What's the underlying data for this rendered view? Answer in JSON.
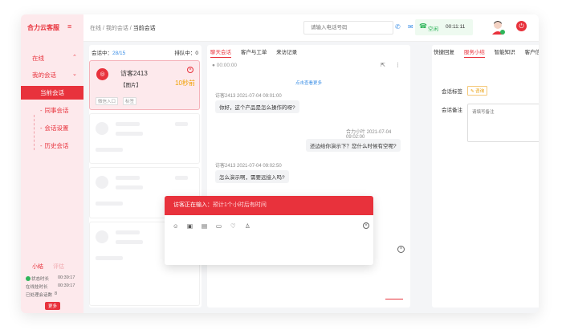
{
  "sidebar": {
    "brand": "合力云客服",
    "menu_icon": "≡",
    "online": "在线",
    "my_sessions": "我的会话",
    "items": [
      {
        "label": "当前会话",
        "active": true
      },
      {
        "label": "同事会话",
        "active": false
      },
      {
        "label": "会话设置",
        "active": false
      },
      {
        "label": "历史会话",
        "active": false
      }
    ],
    "summary_tabs": [
      "小结",
      "评估"
    ],
    "summary": [
      {
        "label": "状态时长",
        "value": "00:39:17"
      },
      {
        "label": "在线挂时长",
        "value": "00:39:17"
      },
      {
        "label": "已处理会话数",
        "value": "8"
      }
    ],
    "more": "更多"
  },
  "header": {
    "breadcrumb": [
      "在线",
      "我的会话",
      "当前会话"
    ],
    "phone_placeholder": "请输入电话号码",
    "status": "空闲",
    "timer": "00:11:11"
  },
  "sessions": {
    "label": "会话中：",
    "count": "28/15",
    "queue": "排队中：0",
    "card": {
      "name": "访客2413",
      "message": "【图片】",
      "seconds": "10秒前",
      "tags": [
        "微信入口",
        "标签"
      ]
    }
  },
  "chat": {
    "tabs": [
      "聊天会话",
      "客户与工单",
      "来访记录"
    ],
    "recording": "00:00:00",
    "more_link": "点击查看更多",
    "messages": [
      {
        "meta": "访客2413  2021-07-04 09:01:00",
        "text": "你好，这个产品是怎么操作的呀?"
      },
      {
        "meta": "合力小叶  2021-07-04 09:02:00",
        "text": "还边给你演示下？您什么时候有空呢?"
      },
      {
        "meta": "访客2413  2021-07-04 09:02:50",
        "text": "怎么演示啊，需要远接入吗?"
      }
    ],
    "typing_label": "访客正在输入：",
    "typing_text": "预计1个小时后有时间"
  },
  "right_panel": {
    "tabs": [
      "快捷回复",
      "服务小结",
      "智能知识",
      "客户信息"
    ],
    "session_tag_label": "会话标签",
    "tag_button": "咨询",
    "session_note_label": "会话备注",
    "note_placeholder": "请填写备注"
  },
  "colors": {
    "brand": "#e8323c",
    "accent_blue": "#3a8ee6",
    "online_green": "#2fb55a"
  }
}
